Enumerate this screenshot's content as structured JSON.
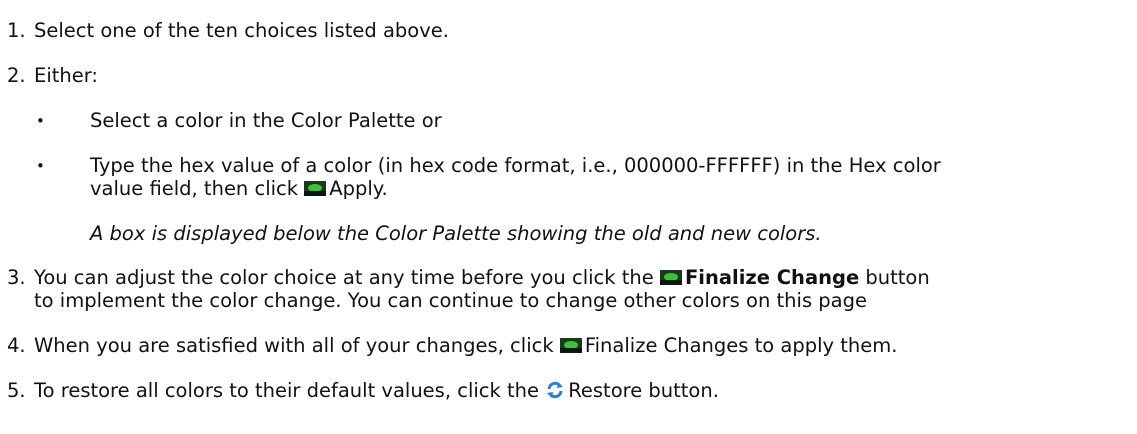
{
  "steps": {
    "s1": {
      "num": "1.",
      "text": "Select one of the ten choices listed above."
    },
    "s2": {
      "num": "2.",
      "text": "Either:"
    },
    "b1": {
      "text": "Select a color in the Color Palette or"
    },
    "b2": {
      "line1": "Type the hex value of a color (in hex code format, i.e., 000000-FFFFFF) in the Hex color",
      "line2_pre": "value field, then click",
      "line2_post": "Apply."
    },
    "note": "A box is displayed below the Color Palette showing the old and new colors.",
    "s3": {
      "num": "3.",
      "line1_pre": "You can adjust the color choice at any time before you click the",
      "line1_bold": "Finalize Change",
      "line1_post": "button",
      "line2": "to implement the color change.  You can continue to change other colors on this page"
    },
    "s4": {
      "num": "4.",
      "pre": "When you are satisfied with all of your changes, click",
      "post": "Finalize Changes to apply them."
    },
    "s5": {
      "num": "5.",
      "pre": "To restore all colors to their default values, click the",
      "post": "Restore button."
    }
  },
  "icons": {
    "apply": "apply-icon",
    "finalize": "finalize-icon",
    "restore": "restore-icon"
  },
  "colors": {
    "icon_green": "#3fbf3f",
    "icon_dark": "#1b3a1b",
    "restore_blue": "#2a7fd4"
  }
}
